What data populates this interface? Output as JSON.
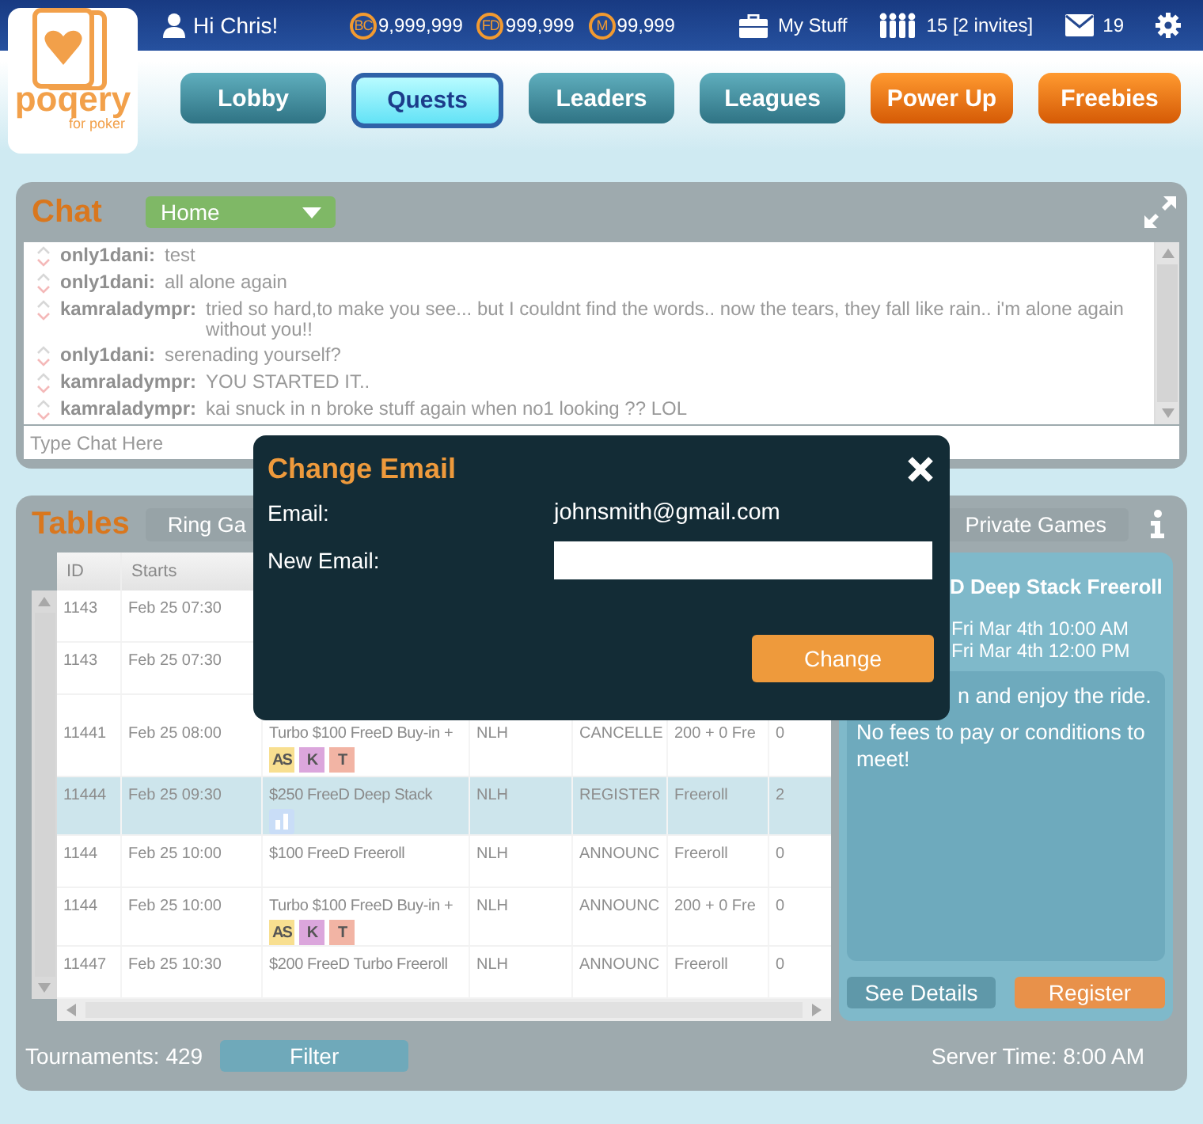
{
  "top_bar": {
    "greeting": "Hi Chris!",
    "currencies": [
      {
        "code": "BC",
        "amount": "9,999,999"
      },
      {
        "code": "FD",
        "amount": "999,999"
      },
      {
        "code": "M",
        "amount": "99,999"
      }
    ],
    "my_stuff": "My Stuff",
    "friends": "15 [2 invites]",
    "messages": "19"
  },
  "logo": {
    "name": "poqery",
    "tagline": "for poker"
  },
  "nav": [
    {
      "label": "Lobby",
      "kind": "main",
      "selected": false
    },
    {
      "label": "Quests",
      "kind": "main",
      "selected": true
    },
    {
      "label": "Leaders",
      "kind": "main",
      "selected": false
    },
    {
      "label": "Leagues",
      "kind": "main",
      "selected": false
    },
    {
      "label": "Power Up",
      "kind": "promo",
      "selected": false
    },
    {
      "label": "Freebies",
      "kind": "promo",
      "selected": false
    }
  ],
  "chat": {
    "title": "Chat",
    "room": "Home",
    "placeholder": "Type Chat Here",
    "messages": [
      {
        "user": "only1dani:",
        "text": "test"
      },
      {
        "user": "only1dani:",
        "text": "all alone again"
      },
      {
        "user": "kamraladympr:",
        "text": "tried so hard,to make you see... but I couldnt find the words.. now the tears, they fall like rain.. i'm alone again without you!!"
      },
      {
        "user": "only1dani:",
        "text": "serenading yourself?"
      },
      {
        "user": "kamraladympr:",
        "text": "YOU STARTED IT.."
      },
      {
        "user": "kamraladympr:",
        "text": "kai snuck in n broke stuff again when no1 looking ?? LOL"
      }
    ]
  },
  "tables": {
    "title": "Tables",
    "tabs": [
      {
        "label": "Ring Ga",
        "selected": false
      },
      {
        "label": "Private Games",
        "selected": false
      }
    ],
    "columns": [
      "ID",
      "Starts"
    ],
    "rows": [
      {
        "id": "1143",
        "starts": "Feb 25 07:30",
        "selected": false
      },
      {
        "id": "1143",
        "starts": "Feb 25 07:30",
        "selected": false
      },
      {
        "id": "11441",
        "starts": "Feb 25 08:00",
        "name": "Turbo $100 FreeD Buy-in +",
        "game": "NLH",
        "status": "CANCELLE",
        "type": "200 + 0 Fre",
        "count": "0",
        "badges": [
          {
            "kind": "letter",
            "label": "AS",
            "color": "#f8df90"
          },
          {
            "kind": "letter",
            "label": "K",
            "color": "#dba6dc"
          },
          {
            "kind": "letter",
            "label": "T",
            "color": "#f2b4a4"
          }
        ],
        "selected": false
      },
      {
        "id": "11444",
        "starts": "Feb 25 09:30",
        "name": "$250 FreeD Deep Stack",
        "game": "NLH",
        "status": "REGISTER",
        "type": "Freeroll",
        "count": "2",
        "badges": [
          {
            "kind": "stats",
            "color": "#c9ddf7"
          }
        ],
        "selected": true
      },
      {
        "id": "1144",
        "starts": "Feb 25 10:00",
        "name": "$100 FreeD Freeroll",
        "game": "NLH",
        "status": "ANNOUNC",
        "type": "Freeroll",
        "count": "0",
        "selected": false
      },
      {
        "id": "1144",
        "starts": "Feb 25 10:00",
        "name": "Turbo $100 FreeD Buy-in +",
        "game": "NLH",
        "status": "ANNOUNC",
        "type": "200 + 0 Fre",
        "count": "0",
        "badges": [
          {
            "kind": "letter",
            "label": "AS",
            "color": "#f8df90"
          },
          {
            "kind": "letter",
            "label": "K",
            "color": "#dba6dc"
          },
          {
            "kind": "letter",
            "label": "T",
            "color": "#f2b4a4"
          }
        ],
        "selected": false
      },
      {
        "id": "11447",
        "starts": "Feb 25 10:30",
        "name": "$200 FreeD Turbo Freeroll",
        "game": "NLH",
        "status": "ANNOUNC",
        "type": "Freeroll",
        "count": "0",
        "selected": false
      }
    ],
    "count": "Tournaments: 429",
    "filter": "Filter",
    "server_time": "Server Time: 8:00 AM"
  },
  "details": {
    "title": "D Deep Stack Freeroll",
    "dates": [
      "Fri Mar 4th 10:00 AM",
      "Fri Mar 4th 12:00 PM"
    ],
    "description_start": "n and enjoy the ride.",
    "description_rest": "No fees to pay or conditions to meet!",
    "see_details": "See Details",
    "register": "Register"
  },
  "modal": {
    "title": "Change Email",
    "email_label": "Email:",
    "email": "johnsmith@gmail.com",
    "new_email_label": "New Email:",
    "submit": "Change"
  }
}
